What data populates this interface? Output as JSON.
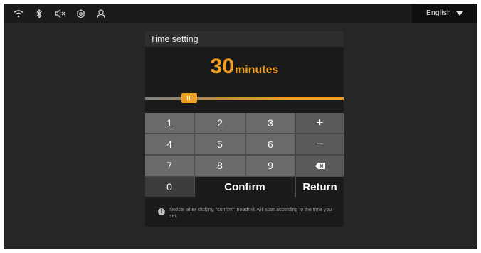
{
  "status_bar": {
    "icons": [
      "wifi-icon",
      "bluetooth-icon",
      "speaker-muted-icon",
      "settings-icon",
      "user-icon"
    ],
    "language": "English"
  },
  "dialog": {
    "title": "Time setting",
    "time_value": "30",
    "time_unit": "minutes",
    "slider_level_fraction": 0.2
  },
  "keypad": {
    "rows": [
      [
        "1",
        "2",
        "3",
        "+"
      ],
      [
        "4",
        "5",
        "6",
        "−"
      ],
      [
        "7",
        "8",
        "9",
        "backspace-icon"
      ]
    ],
    "zero": "0",
    "confirm": "Confirm",
    "return": "Return"
  },
  "notice": {
    "icon": "!",
    "text": "Notice: after clicking \"confirm\",treadmill will start according to the time you set."
  },
  "colors": {
    "accent": "#f0a020",
    "background": "#262626",
    "key": "#6b6b6b"
  }
}
